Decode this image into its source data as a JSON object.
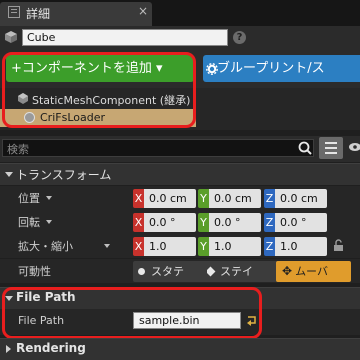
{
  "window": {
    "tab_title": "詳細",
    "tab_close": "×"
  },
  "name_field": {
    "value": "Cube"
  },
  "help": {
    "label": "?"
  },
  "toolbar": {
    "add_component_label": "+コンポーネントを追加 ▾",
    "blueprint_label": "ブループリント/ス"
  },
  "components": {
    "items": [
      {
        "label": "StaticMeshComponent (継承)"
      },
      {
        "label": "CriFsLoader"
      }
    ]
  },
  "search": {
    "placeholder": "検索"
  },
  "transform": {
    "title": "トランスフォーム",
    "rows": [
      {
        "label": "位置",
        "x": "0.0 cm",
        "y": "0.0 cm",
        "z": "0.0 cm"
      },
      {
        "label": "回転",
        "x": "0.0 °",
        "y": "0.0 °",
        "z": "0.0 °"
      },
      {
        "label": "拡大・縮小",
        "x": "1.0",
        "y": "1.0",
        "z": "1.0"
      }
    ],
    "axis_labels": {
      "x": "X",
      "y": "Y",
      "z": "Z"
    },
    "mobility": {
      "label": "可動性",
      "options": [
        "スタテ",
        "ステイ",
        "ムーバ"
      ],
      "selected": "ムーバ"
    }
  },
  "file_path_section": {
    "title": "File Path",
    "property_label": "File Path",
    "value": "sample.bin"
  },
  "rendering_section": {
    "title": "Rendering"
  },
  "colors": {
    "add_button": "#3c9e2a",
    "blueprint_button": "#2c7fc2",
    "selected_component": "#c7a773",
    "highlight": "#e81e1e",
    "axis_x": "#c8322c",
    "axis_y": "#5a9e2a",
    "axis_z": "#2e68bf",
    "mobility_active": "#e09c2c"
  },
  "icons": [
    "details-icon",
    "cube-icon",
    "help-icon",
    "gear-icon",
    "component-icon",
    "loader-icon",
    "search-icon",
    "list-view-icon",
    "eye-icon",
    "lock-icon",
    "browse-icon"
  ]
}
